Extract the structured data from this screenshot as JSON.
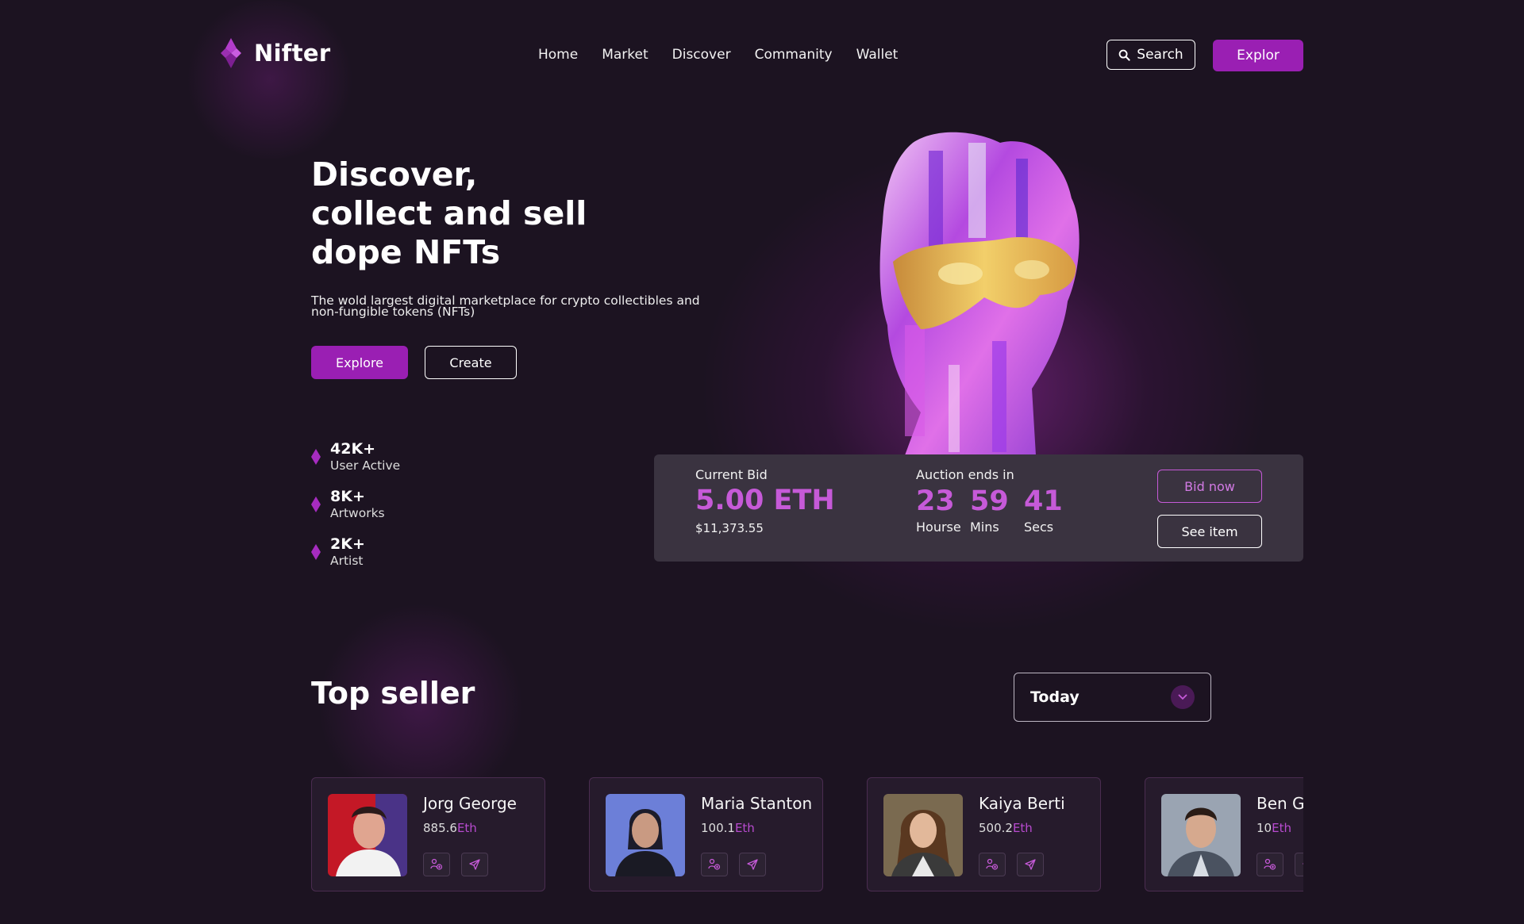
{
  "brand": {
    "name": "Nifter",
    "accent": "#9a1fb3",
    "highlight": "#c65ad8"
  },
  "nav": {
    "items": [
      "Home",
      "Market",
      "Discover",
      "Commanity",
      "Wallet"
    ]
  },
  "header": {
    "search_label": "Search",
    "explore_label": "Explor"
  },
  "hero": {
    "title_lines": [
      "Discover,",
      "collect and sell",
      "dope NFTs"
    ],
    "description": "The wold largest digital marketplace for crypto collectibles and non-fungible tokens (NFTs)",
    "explore_label": "Explore",
    "create_label": "Create"
  },
  "stats": [
    {
      "value": "42K+",
      "label": "User Active"
    },
    {
      "value": "8K+",
      "label": "Artworks"
    },
    {
      "value": "2K+",
      "label": "Artist"
    }
  ],
  "bid": {
    "current_label": "Current Bid",
    "eth": "5.00 ETH",
    "usd": "$11,373.55",
    "auction_label": "Auction ends in",
    "timer": [
      {
        "value": "23",
        "label": "Hourse"
      },
      {
        "value": "59",
        "label": "Mins"
      },
      {
        "value": "41",
        "label": "Secs"
      }
    ],
    "bid_now_label": "Bid now",
    "see_item_label": "See item"
  },
  "top_seller": {
    "title": "Top seller",
    "filter_selected": "Today",
    "sellers": [
      {
        "name": "Jorg George",
        "amount": "885.6",
        "unit": "Eth"
      },
      {
        "name": "Maria Stanton",
        "amount": "100.1",
        "unit": "Eth"
      },
      {
        "name": "Kaiya Berti",
        "amount": "500.2",
        "unit": "Eth"
      },
      {
        "name": "Ben Gray",
        "amount": "10",
        "unit": "Eth"
      }
    ]
  },
  "icons": {
    "logo": "nifter-diamond-icon",
    "search": "search-icon",
    "stat": "diamond-icon",
    "dropdown": "chevron-down-icon",
    "follow": "user-plus-icon",
    "message": "send-icon"
  }
}
